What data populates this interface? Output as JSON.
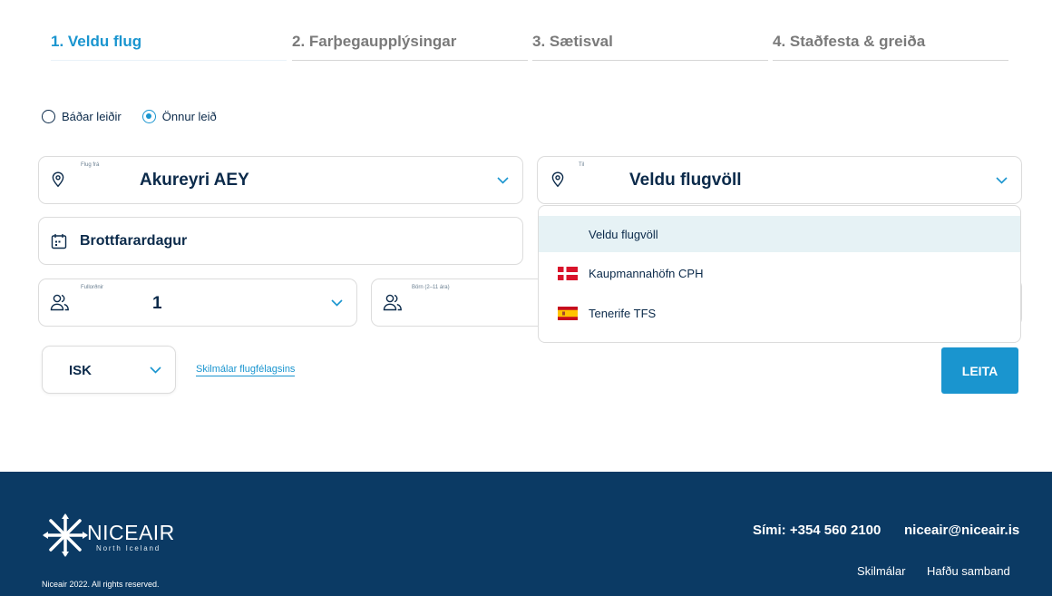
{
  "steps": [
    {
      "label": "1. Veldu flug",
      "active": true
    },
    {
      "label": "2. Farþegaupplýsingar",
      "active": false
    },
    {
      "label": "3. Sætisval",
      "active": false
    },
    {
      "label": "4. Staðfesta & greiða",
      "active": false
    }
  ],
  "trip_type": {
    "options": [
      "Báðar leiðir",
      "Önnur leið"
    ],
    "selected": "Önnur leið"
  },
  "from": {
    "micro_label": "Flug frá",
    "value": "Akureyri AEY"
  },
  "to": {
    "micro_label": "Til",
    "value": "Veldu flugvöll"
  },
  "date": {
    "value": "Brottfarardagur"
  },
  "adults": {
    "micro_label": "Fullorðnir",
    "value": "1"
  },
  "children": {
    "micro_label": "Börn (2–11 ára)"
  },
  "to_dropdown": {
    "options": [
      {
        "label": "Veldu flugvöll",
        "flag": "",
        "selected": true
      },
      {
        "label": "Kaupmannahöfn CPH",
        "flag": "denmark-flag",
        "selected": false
      },
      {
        "label": "Tenerife TFS",
        "flag": "spain-flag",
        "selected": false
      }
    ]
  },
  "currency": {
    "value": "ISK"
  },
  "terms_link": "Skilmálar flugfélagsins",
  "search_button": "LEITA",
  "footer": {
    "logo_text": "NICEAIR",
    "logo_sub": "North Iceland",
    "rights": "Niceair 2022. All rights reserved.",
    "phone": "Sími: +354 560 2100",
    "email": "niceair@niceair.is",
    "links": [
      "Skilmálar",
      "Hafðu samband"
    ]
  },
  "colors": {
    "accent": "#1a95cf",
    "navy": "#0b3a64",
    "text": "#0b2a4a"
  }
}
